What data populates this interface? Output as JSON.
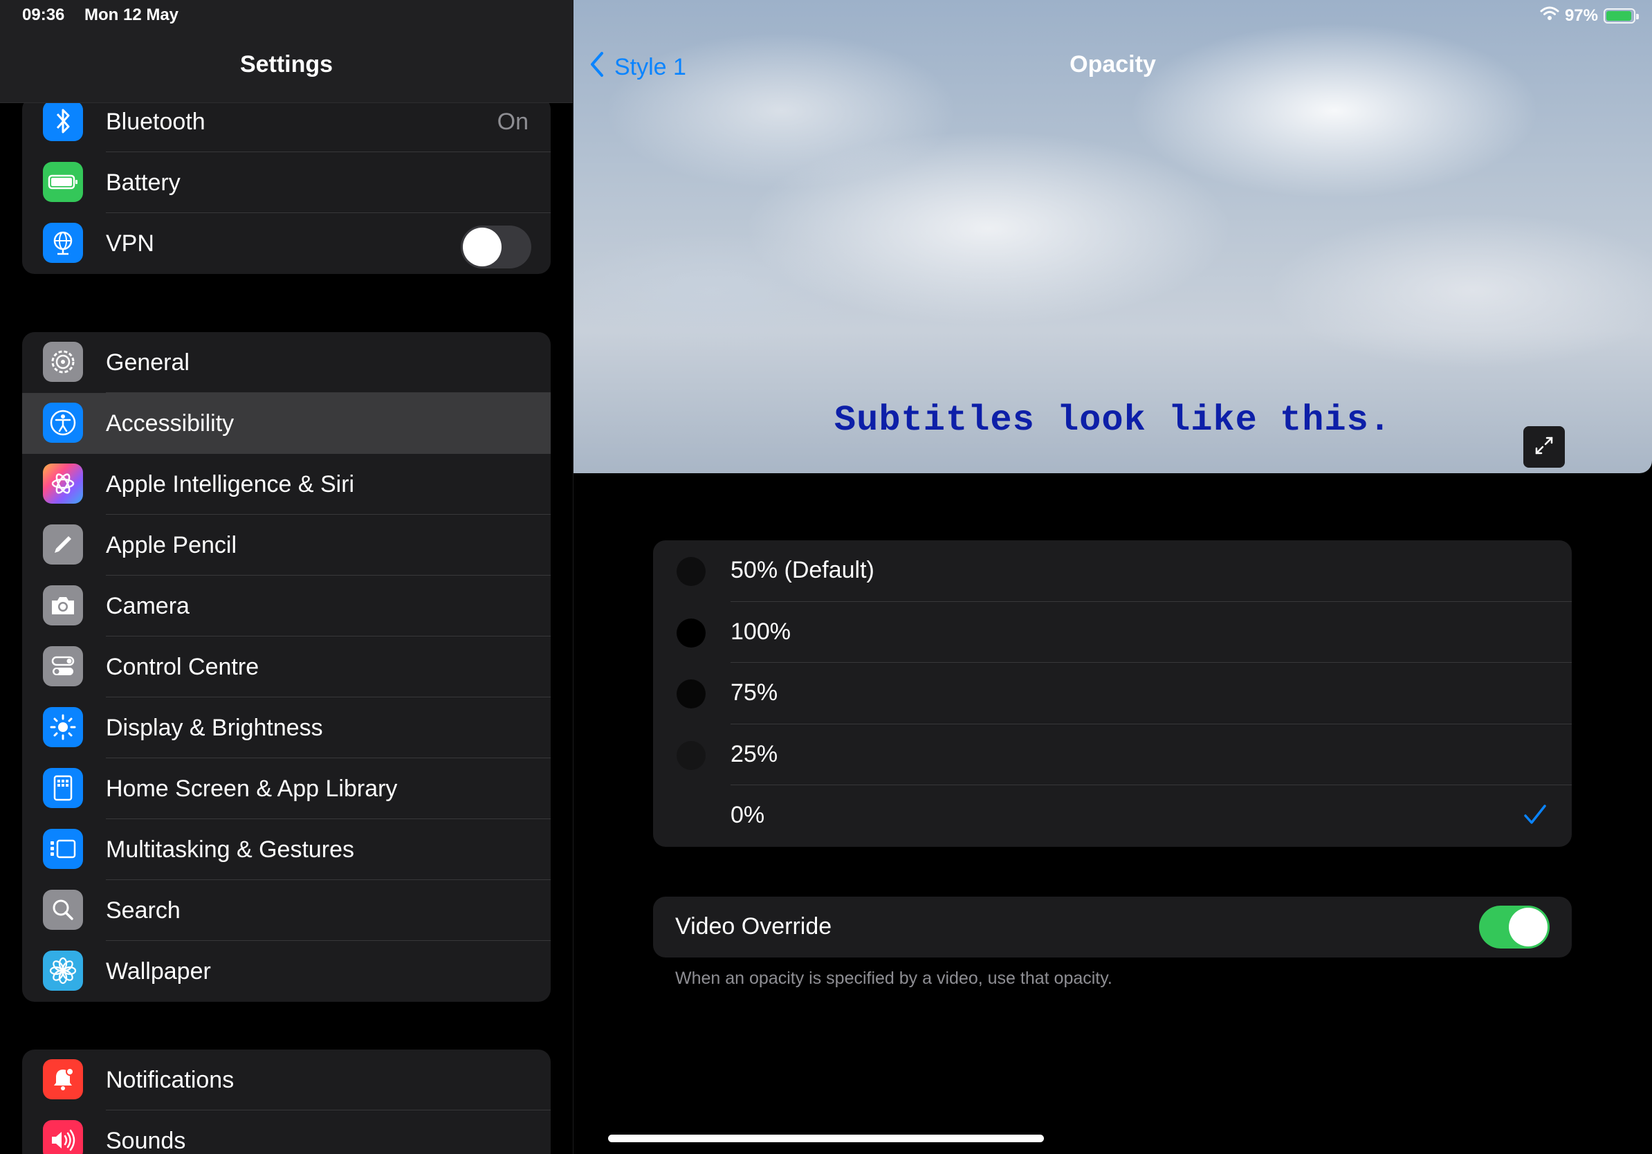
{
  "status": {
    "time": "09:36",
    "date": "Mon 12 May",
    "battery": "97%"
  },
  "sidebar": {
    "title": "Settings",
    "group1": [
      {
        "label": "Bluetooth",
        "value": "On",
        "icon": "bluetooth-icon",
        "color": "#0a84ff"
      },
      {
        "label": "Battery",
        "icon": "battery-icon",
        "color": "#34c759"
      },
      {
        "label": "VPN",
        "icon": "vpn-globe-icon",
        "color": "#0a84ff",
        "toggle": false
      }
    ],
    "group2": [
      {
        "label": "General",
        "icon": "gear-icon",
        "color": "#8e8e93"
      },
      {
        "label": "Accessibility",
        "icon": "accessibility-icon",
        "color": "#0a84ff",
        "selected": true
      },
      {
        "label": "Apple Intelligence & Siri",
        "icon": "siri-icon",
        "color": "#ff6b9a"
      },
      {
        "label": "Apple Pencil",
        "icon": "pencil-icon",
        "color": "#8e8e93"
      },
      {
        "label": "Camera",
        "icon": "camera-icon",
        "color": "#8e8e93"
      },
      {
        "label": "Control Centre",
        "icon": "control-centre-icon",
        "color": "#8e8e93"
      },
      {
        "label": "Display & Brightness",
        "icon": "sun-icon",
        "color": "#0a84ff"
      },
      {
        "label": "Home Screen & App Library",
        "icon": "home-screen-icon",
        "color": "#0a84ff"
      },
      {
        "label": "Multitasking & Gestures",
        "icon": "multitasking-icon",
        "color": "#0a84ff"
      },
      {
        "label": "Search",
        "icon": "search-icon",
        "color": "#8e8e93"
      },
      {
        "label": "Wallpaper",
        "icon": "wallpaper-flower-icon",
        "color": "#32ade6"
      }
    ],
    "group3": [
      {
        "label": "Notifications",
        "icon": "bell-icon",
        "color": "#ff3b30"
      },
      {
        "label": "Sounds",
        "icon": "speaker-icon",
        "color": "#ff2d55"
      }
    ]
  },
  "detail": {
    "back_label": "Style 1",
    "title": "Opacity",
    "preview_text": "Subtitles look like this.",
    "options": [
      {
        "label": "50% (Default)"
      },
      {
        "label": "100%"
      },
      {
        "label": "75%"
      },
      {
        "label": "25%"
      },
      {
        "label": "0%",
        "selected": true
      }
    ],
    "override_label": "Video Override",
    "override_on": true,
    "footnote": "When an opacity is specified by a video, use that opacity."
  }
}
